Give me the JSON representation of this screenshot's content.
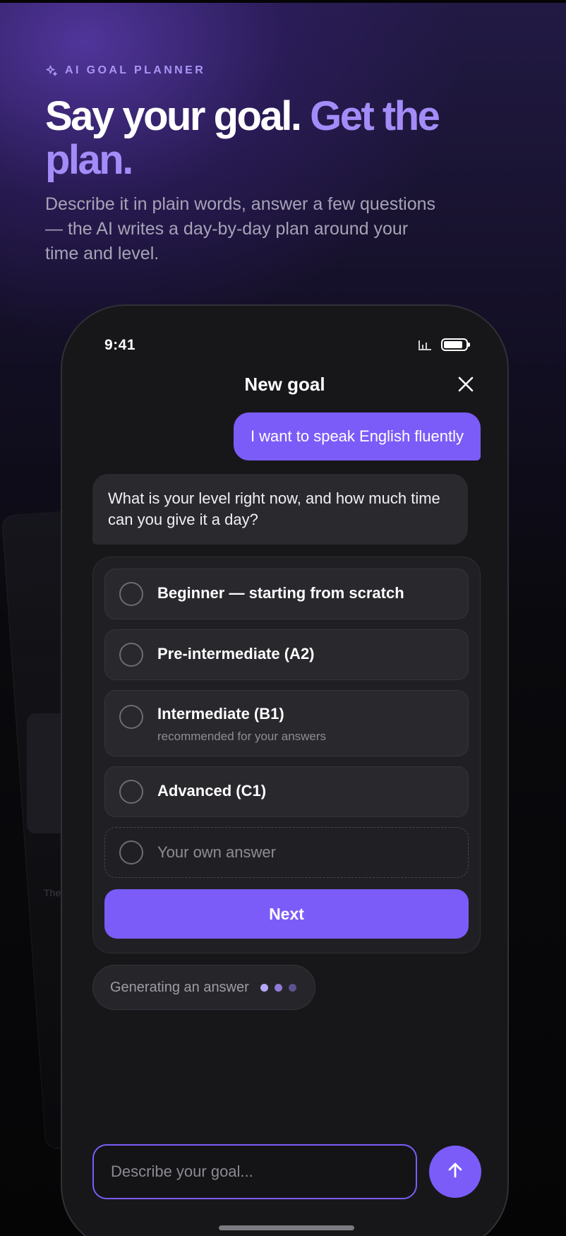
{
  "hero": {
    "eyebrow": "AI GOAL PLANNER",
    "eyebrow_icon": "sparkle-icon",
    "headline_main": "Say your goal.",
    "headline_accent": "Get the plan.",
    "subhead": "Describe it in plain words, answer a few questions — the AI writes a day-by-day plan around your time and level."
  },
  "background_card": {
    "text": "The"
  },
  "phone": {
    "status": {
      "time": "9:41",
      "icons": [
        "signal-icon",
        "battery-icon"
      ]
    },
    "header": {
      "title": "New goal",
      "close_icon": "close-icon"
    },
    "chat": {
      "user_message": "I want to speak English fluently",
      "ai_question": "What is your level right now, and how much time can you give it a day?"
    },
    "options": [
      {
        "label": "Beginner — starting from scratch",
        "hint": ""
      },
      {
        "label": "Pre-intermediate (A2)",
        "hint": ""
      },
      {
        "label": "Intermediate (B1)",
        "hint": "recommended for your answers"
      },
      {
        "label": "Advanced (C1)",
        "hint": ""
      }
    ],
    "own_answer_placeholder": "Your own answer",
    "next_label": "Next",
    "generating_label": "Generating an answer",
    "input_placeholder": "Describe your goal...",
    "send_icon": "arrow-up-icon"
  },
  "colors": {
    "accent": "#7b5cf8",
    "accent_light": "#a48cf8",
    "phone_bg": "#17171a",
    "card_bg": "#202024",
    "option_bg": "#28282d"
  }
}
